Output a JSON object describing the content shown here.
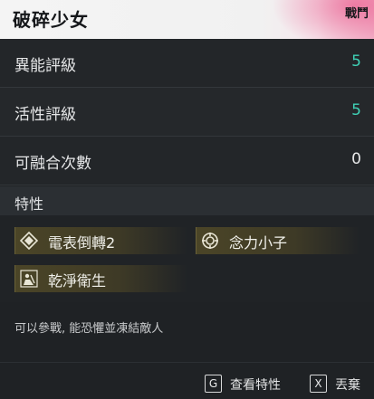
{
  "header": {
    "title": "破碎少女",
    "category": "戰鬥"
  },
  "stats": [
    {
      "label": "異能評級",
      "value": "5",
      "accent": true
    },
    {
      "label": "活性評級",
      "value": "5",
      "accent": true
    },
    {
      "label": "可融合次數",
      "value": "0",
      "accent": false
    }
  ],
  "traits": {
    "heading": "特性",
    "items": [
      {
        "label": "電表倒轉2",
        "icon": "diamond-icon"
      },
      {
        "label": "念力小子",
        "icon": "target-icon"
      },
      {
        "label": "乾淨衛生",
        "icon": "cleaning-icon"
      }
    ]
  },
  "description": "可以參戰, 能恐懼並凍結敵人",
  "footer": {
    "view_key": "G",
    "view_label": "查看特性",
    "discard_key": "X",
    "discard_label": "丟棄"
  },
  "colors": {
    "accent": "#3fd1b6",
    "chip": "#4b4527",
    "header_pink": "#e63c78"
  }
}
